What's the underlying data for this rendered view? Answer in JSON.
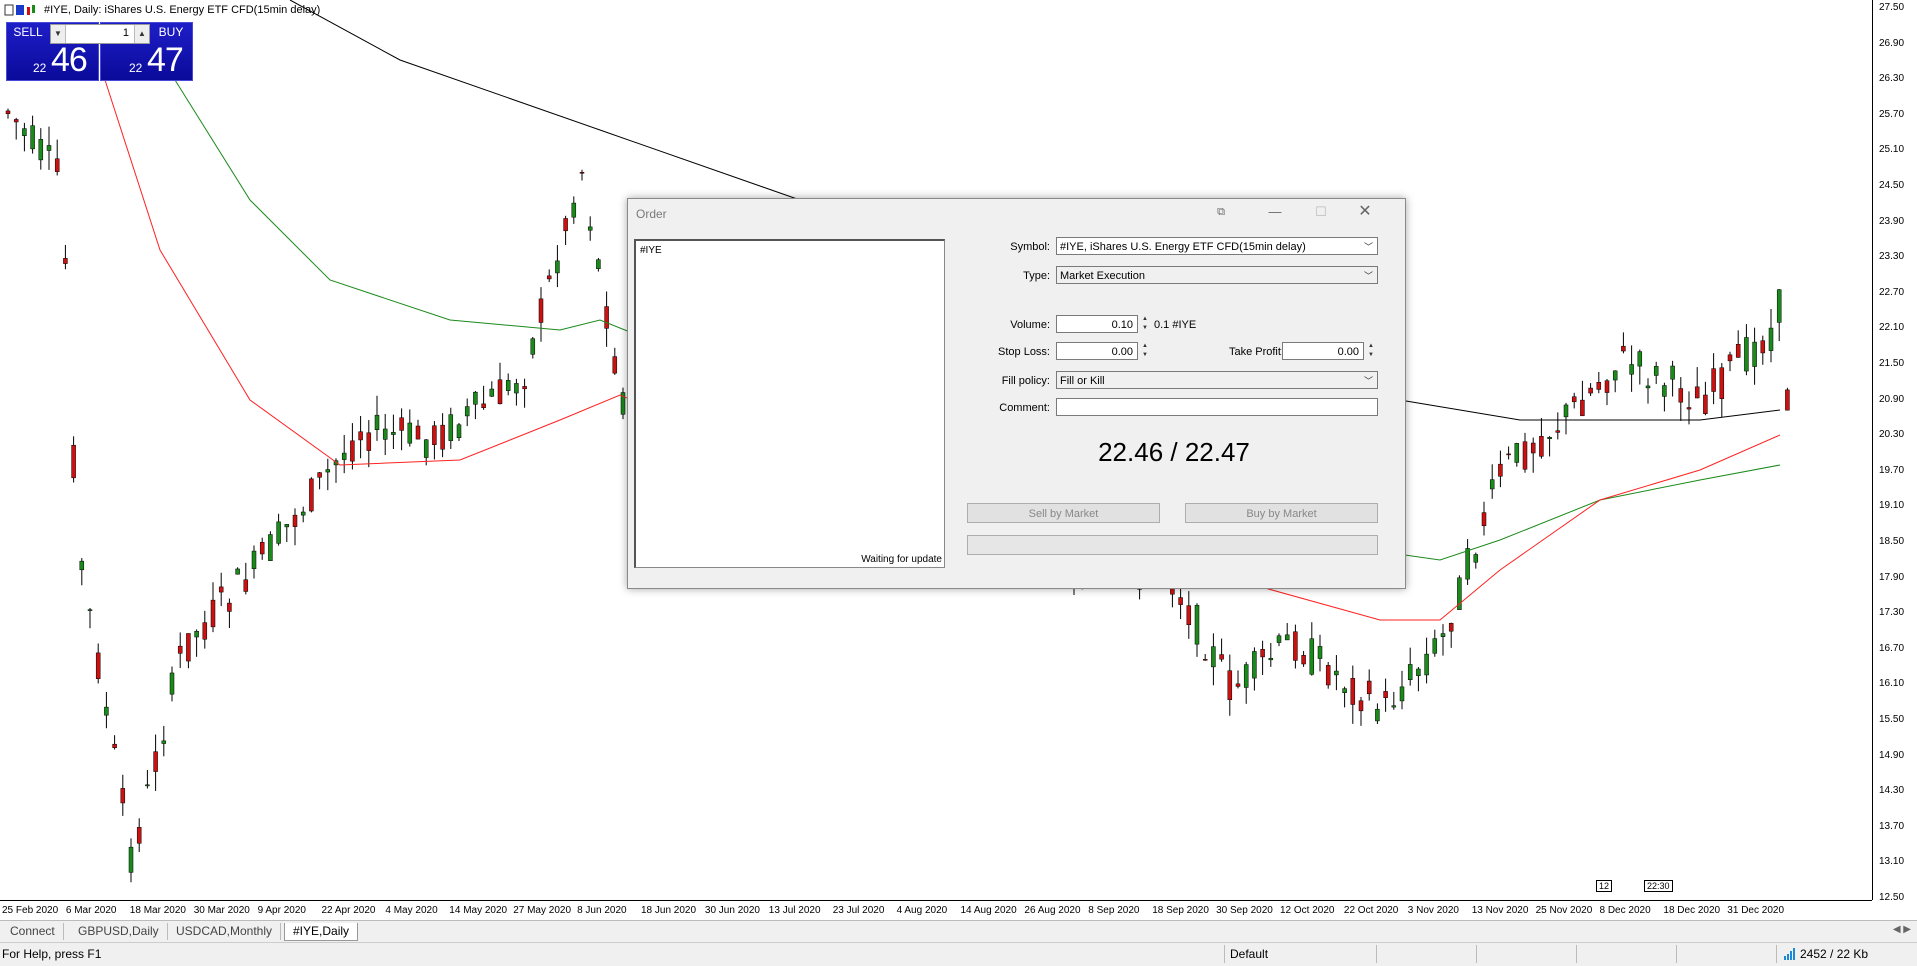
{
  "chart": {
    "title": "#IYE, Daily:  iShares U.S. Energy ETF CFD(15min delay)",
    "price_labels": [
      "27.50",
      "26.90",
      "26.30",
      "25.70",
      "25.10",
      "24.50",
      "23.90",
      "23.30",
      "22.70",
      "22.10",
      "21.50",
      "20.90",
      "20.30",
      "19.70",
      "19.10",
      "18.50",
      "17.90",
      "17.30",
      "16.70",
      "16.10",
      "15.50",
      "14.90",
      "14.30",
      "13.70",
      "13.10",
      "12.50"
    ],
    "date_labels": [
      "25 Feb 2020",
      "6 Mar 2020",
      "18 Mar 2020",
      "30 Mar 2020",
      "9 Apr 2020",
      "22 Apr 2020",
      "4 May 2020",
      "14 May 2020",
      "27 May 2020",
      "8 Jun 2020",
      "18 Jun 2020",
      "30 Jun 2020",
      "13 Jul 2020",
      "23 Jul 2020",
      "4 Aug 2020",
      "14 Aug 2020",
      "26 Aug 2020",
      "8 Sep 2020",
      "18 Sep 2020",
      "30 Sep 2020",
      "12 Oct 2020",
      "22 Oct 2020",
      "3 Nov 2020",
      "13 Nov 2020",
      "25 Nov 2020",
      "8 Dec 2020",
      "18 Dec 2020",
      "31 Dec 2020"
    ],
    "time_flag_1": "12",
    "time_flag_2": "22:30",
    "colors": {
      "bull": "#1a8a1a",
      "bear": "#cc1111",
      "ma_black": "#000000",
      "ma_green": "#1a8a1a",
      "ma_red": "#ff2020"
    }
  },
  "trade_panel": {
    "sell_label": "SELL",
    "buy_label": "BUY",
    "volume": "1",
    "sell_price_small": "22",
    "sell_price_big": "46",
    "buy_price_small": "22",
    "buy_price_big": "47"
  },
  "order_dialog": {
    "title": "Order",
    "tick_symbol": "#IYE",
    "tick_status": "Waiting for update",
    "symbol_label": "Symbol:",
    "symbol_value": "#IYE, iShares U.S. Energy ETF CFD(15min delay)",
    "type_label": "Type:",
    "type_value": "Market Execution",
    "volume_label": "Volume:",
    "volume_value": "0.10",
    "volume_hint": "0.1 #IYE",
    "stoploss_label": "Stop Loss:",
    "stoploss_value": "0.00",
    "takeprofit_label": "Take Profit:",
    "takeprofit_value": "0.00",
    "fillpolicy_label": "Fill policy:",
    "fillpolicy_value": "Fill or Kill",
    "comment_label": "Comment:",
    "comment_value": "",
    "quote": "22.46 / 22.47",
    "sell_button": "Sell by Market",
    "buy_button": "Buy by Market"
  },
  "tabs": [
    "Connect",
    "GBPUSD,Daily",
    "USDCAD,Monthly",
    "#IYE,Daily"
  ],
  "status": {
    "help": "For Help, press F1",
    "profile": "Default",
    "traffic": "2452 / 22 Kb"
  }
}
